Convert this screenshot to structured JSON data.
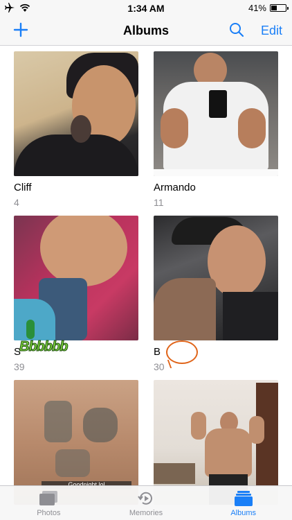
{
  "status": {
    "time": "1:34 AM",
    "battery_percent": "41%",
    "battery_level": 0.41
  },
  "nav": {
    "title": "Albums",
    "edit_label": "Edit",
    "add_icon": "plus-icon",
    "search_icon": "search-icon"
  },
  "albums": [
    {
      "name": "Cliff",
      "count": "4"
    },
    {
      "name": "Armando",
      "count": "11"
    },
    {
      "name": "S",
      "count": "39",
      "sticker": "Bbbbbb"
    },
    {
      "name": "B",
      "count": "30"
    },
    {
      "name": "",
      "count": "",
      "caption": "Goodnight lol"
    },
    {
      "name": "",
      "count": ""
    }
  ],
  "tabs": [
    {
      "label": "Photos",
      "icon": "photos-icon"
    },
    {
      "label": "Memories",
      "icon": "memories-icon"
    },
    {
      "label": "Albums",
      "icon": "albums-icon",
      "active": true
    }
  ],
  "colors": {
    "accent": "#1a7ff7",
    "inactive": "#8e8e93"
  }
}
